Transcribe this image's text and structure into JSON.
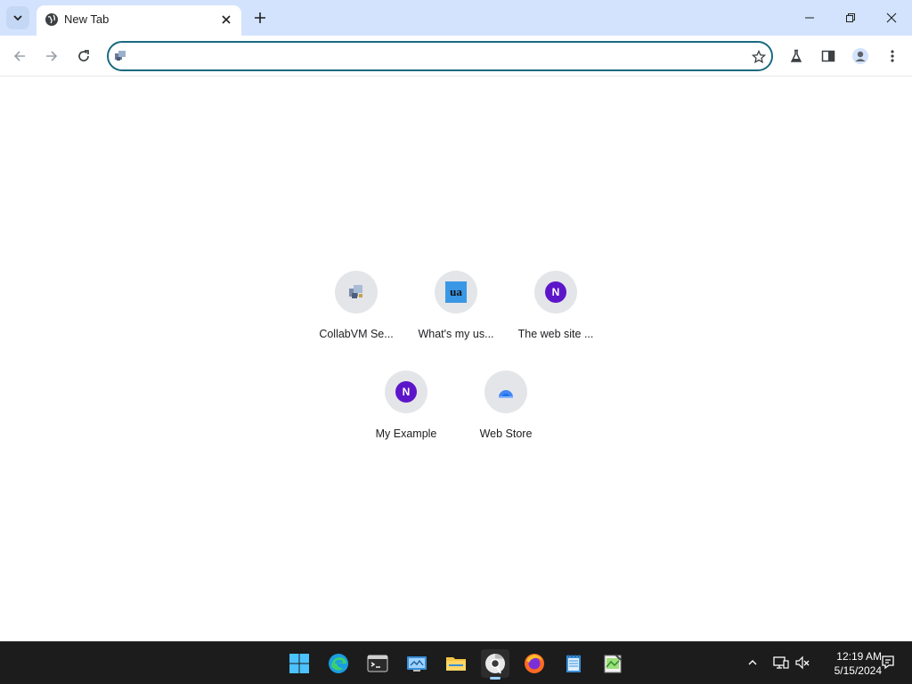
{
  "browser": {
    "tab": {
      "title": "New Tab"
    },
    "address_bar": {
      "value": "",
      "placeholder": ""
    }
  },
  "shortcuts": [
    {
      "label": "CollabVM Se...",
      "icon": "collabvm-icon"
    },
    {
      "label": "What's my us...",
      "icon": "ua-icon",
      "badge_text": "ua"
    },
    {
      "label": "The web site ...",
      "icon": "n-letter-icon",
      "badge_text": "N"
    },
    {
      "label": "My Example",
      "icon": "n-letter-icon",
      "badge_text": "N"
    },
    {
      "label": "Web Store",
      "icon": "web-store-icon"
    }
  ],
  "taskbar": {
    "apps": [
      "windows-start-icon",
      "edge-icon",
      "terminal-icon",
      "control-panel-icon",
      "file-explorer-icon",
      "chrome-icon",
      "firefox-icon",
      "notepad-icon",
      "image-editor-icon"
    ],
    "clock": {
      "time": "12:19 AM",
      "date": "5/15/2024"
    }
  },
  "colors": {
    "tabstrip_bg": "#d3e3fd",
    "omnibox_border": "#1a6a80",
    "shortcut_circle": "#e3e5e8",
    "n_badge": "#5c16c9",
    "taskbar_bg": "#1c1c1c"
  }
}
